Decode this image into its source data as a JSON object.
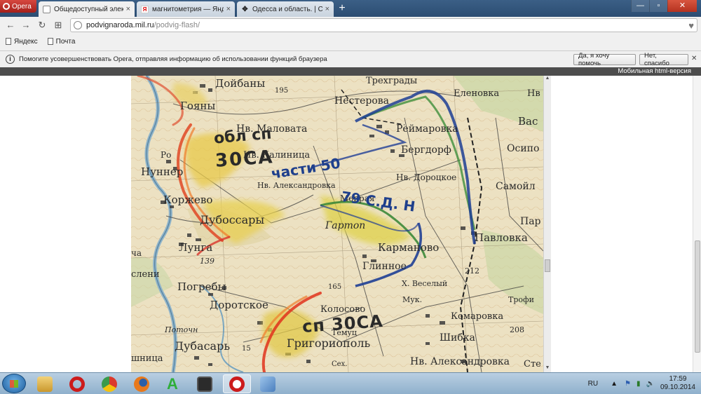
{
  "browser": {
    "menu_label": "Opera",
    "tabs": [
      {
        "title": "Общедоступный электрон",
        "close": "×",
        "favicon": "opera-tab-icon",
        "active": true
      },
      {
        "title": "магнитометрия — Яндекс",
        "close": "×",
        "favicon": "yandex-tab-icon",
        "active": false
      },
      {
        "title": "Одесса и область. | Стра",
        "close": "×",
        "favicon": "page-tab-icon",
        "active": false
      }
    ],
    "new_tab": "+",
    "window_controls": {
      "minimize": "—",
      "maximize": "▫",
      "close": "✕"
    },
    "nav": {
      "back": "←",
      "forward": "→",
      "reload": "↻",
      "speeddial": "⊞"
    },
    "address": {
      "host": "podvignaroda.mil.ru",
      "path": "/podvig-flash/"
    },
    "heart": "♥",
    "bookmarks": [
      {
        "label": "Яндекс"
      },
      {
        "label": "Почта"
      }
    ],
    "infobar": {
      "icon": "i",
      "message": "Помогите усовершенствовать Opera, отправляя информацию об использовании функций браузера",
      "accept": "Да, я хочу помочь",
      "decline": "Нет, спасибо"
    }
  },
  "page": {
    "mobile_link": "Мобильная html-версия",
    "map": {
      "settlements": {
        "doibany": "Дойбаны",
        "goiany": "Гояны",
        "num195": "195",
        "trekhrady": "Трехграды",
        "nesterova": "Нестерова",
        "elenovka": "Еленовка",
        "nv_edge": "Нв",
        "reimarovka": "Реймаровка",
        "vas": "Вас",
        "nv_malovata": "Нв. Маловата",
        "bergdorf": "Бергдорф",
        "osipov": "Осипо",
        "ro": "Ро",
        "nunner": "Нуннер",
        "korzhevo": "Коржево",
        "dubossary": "Дубоссары",
        "lunga": "Лунга",
        "num139": "139",
        "chacha": "ча",
        "sleni": "слени",
        "pogreby": "Погребы",
        "dorotskoe": "Доротское",
        "nv_aleksandrovka": "Нв. Александровка",
        "nv_dorotskoe": "Нв. Дороцкое",
        "samoil": "Самойл",
        "par": "Пар",
        "mokraya": "Мокрая",
        "gartop": "Гартоп",
        "karmanovo": "Карманово",
        "pavlovka": "Павловка",
        "glinnoe": "Глинное",
        "num212": "212",
        "kh_veselyi": "Х. Веселый",
        "num165": "165",
        "muk": "Мук.",
        "trofi": "Трофи",
        "kolosovo": "Колосово",
        "komarovka": "Комаровка",
        "num208": "208",
        "potochn": "Поточн",
        "temuts": "Темуц",
        "shibka": "Шибка",
        "dubasar": "Дубасарь",
        "num15": "15",
        "grigoriopol": "Григориополь",
        "shnitsa": "шница",
        "nv_aleksandrovka2": "Нв. Александровка",
        "sekh": "Сех.",
        "ste": "Сте",
        "nv_kaltnitsa": "Нв. Калиница"
      },
      "annotations": {
        "obl_sp": "обл сп",
        "zosa_top": "30СА",
        "chasti": "части 50",
        "n_79": "79 С.Д. Н",
        "sp_zosa": "сп 30СА"
      }
    }
  },
  "taskbar": {
    "apps": [
      {
        "name": "explorer",
        "color": "#e8c25a"
      },
      {
        "name": "opera",
        "color": "#cc1b1b"
      },
      {
        "name": "chrome",
        "color": "#3a8f3a"
      },
      {
        "name": "firefox",
        "color": "#e07a1f"
      },
      {
        "name": "arhicad",
        "color": "#2fae3a"
      },
      {
        "name": "monitor",
        "color": "#2b2b2b"
      },
      {
        "name": "opera-active",
        "color": "#cc1b1b"
      },
      {
        "name": "paint",
        "color": "#5b8fc9"
      }
    ],
    "language": "RU",
    "time": "17:59",
    "date": "09.10.2014"
  }
}
